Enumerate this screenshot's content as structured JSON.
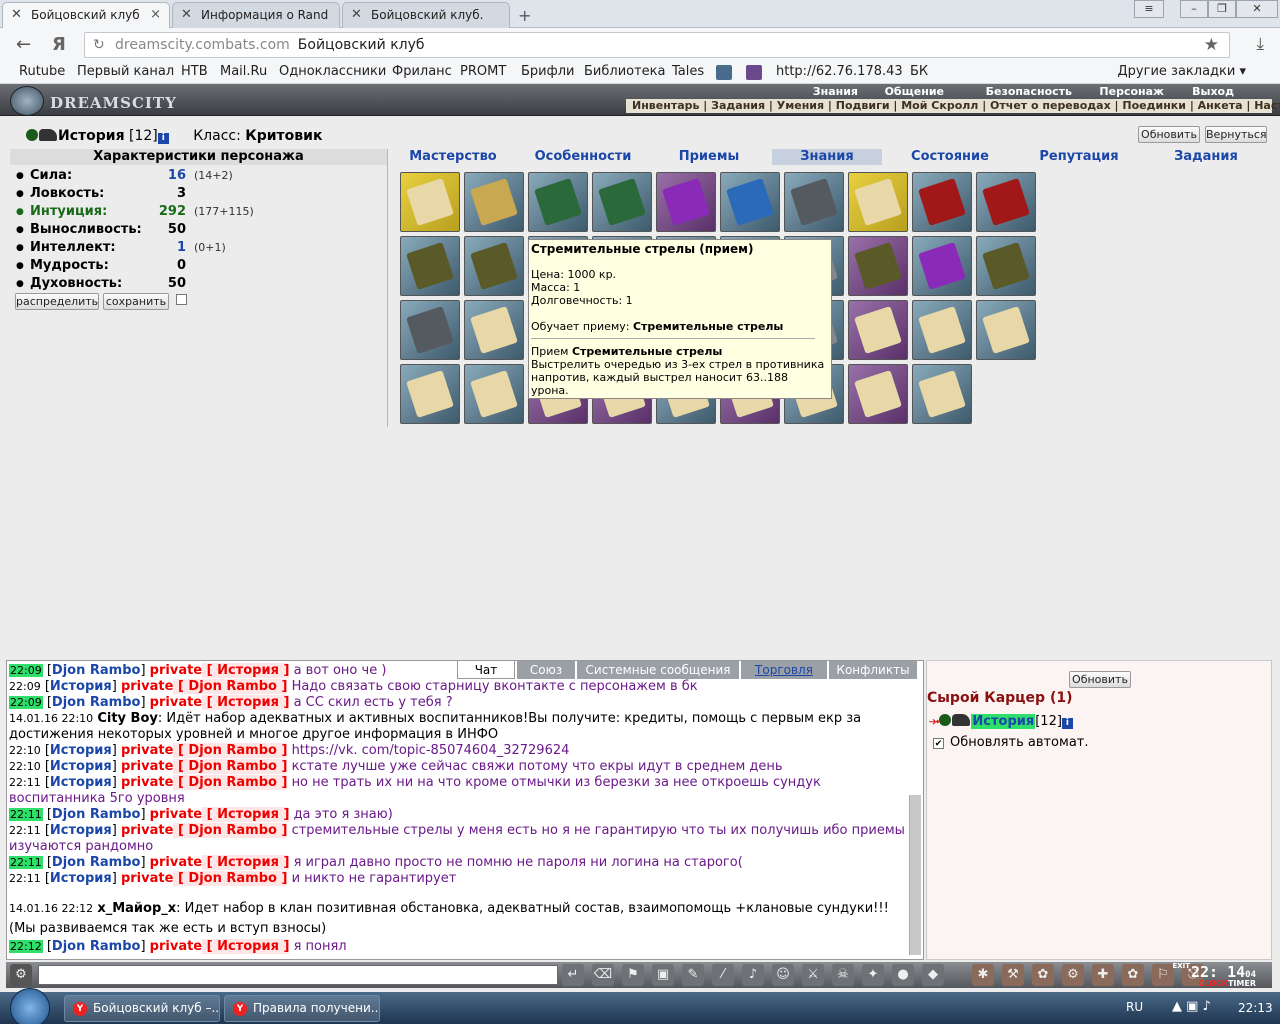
{
  "browser": {
    "tabs": [
      {
        "label": "Бойцовский клуб",
        "active": true
      },
      {
        "label": "Информация о Rand",
        "active": false
      },
      {
        "label": "Бойцовский клуб.",
        "active": false
      }
    ],
    "url": "dreamscity.combats.com",
    "page_title": "Бойцовский клуб",
    "bookmarks": [
      "Rutube",
      "Первый канал",
      "НТВ",
      "Mail.Ru",
      "Одноклассники",
      "Фриланс",
      "PROMT",
      "Брифли",
      "Библиотека",
      "Tales",
      "http://62.76.178.43",
      "БК"
    ],
    "other_bookmarks": "Другие закладки"
  },
  "game": {
    "logo": "DREAMSCITY",
    "top_menu": [
      "Знания",
      "Общение",
      "Безопасность",
      "Персонаж",
      "Выход"
    ],
    "sub_menu": [
      "Инвентарь",
      "Задания",
      "Умения",
      "Подвиги",
      "Мой Скролл",
      "Отчет о переводах",
      "Поединки",
      "Анкета",
      "Настройки"
    ],
    "character": {
      "name": "История",
      "level": "[12]",
      "class_label": "Класс:",
      "class_value": "Критовик",
      "info_icon": "i"
    },
    "buttons": {
      "refresh": "Обновить",
      "back": "Вернуться",
      "distribute": "распределить",
      "save": "сохранить"
    },
    "stats_header": "Характеристики персонажа",
    "stats": [
      {
        "name": "Сила:",
        "value": "16",
        "bonus": "(14+2)",
        "style": "blue"
      },
      {
        "name": "Ловкость:",
        "value": "3",
        "bonus": "",
        "style": "plain"
      },
      {
        "name": "Интуиция:",
        "value": "292",
        "bonus": "(177+115)",
        "style": "green"
      },
      {
        "name": "Выносливость:",
        "value": "50",
        "bonus": "",
        "style": "plain"
      },
      {
        "name": "Интеллект:",
        "value": "1",
        "bonus": "(0+1)",
        "style": "blue"
      },
      {
        "name": "Мудрость:",
        "value": "0",
        "bonus": "",
        "style": "plain"
      },
      {
        "name": "Духовность:",
        "value": "50",
        "bonus": "",
        "style": "plain"
      }
    ],
    "right_tabs": [
      "Мастерство",
      "Особенности",
      "Приемы",
      "Знания",
      "Состояние",
      "Репутация",
      "Задания"
    ],
    "selected_tab": "Знания",
    "tooltip": {
      "title": "Стремительные стрелы (прием)",
      "price": "Цена: 1000 кр.",
      "mass": "Масса: 1",
      "durability": "Долговечность: 1",
      "teaches_label": "Обучает приему:",
      "teaches_value": "Стремительные стрелы",
      "desc_label": "Прием",
      "desc_name": "Стремительные стрелы",
      "desc_text": "Выстрелить очередью из 3-ех стрел в противника напротив, каждый выстрел наносит 63..188 урона."
    }
  },
  "chat": {
    "tabs": [
      "Чат",
      "Союз",
      "Системные сообщения",
      "Торговля",
      "Конфликты"
    ],
    "lines": [
      {
        "time": "22:09",
        "hl": true,
        "from": "Djon Rambo",
        "to": "История",
        "text": "а вот оно че )"
      },
      {
        "time": "22:09",
        "hl": false,
        "from": "История",
        "to": "Djon Rambo",
        "text": "Надо связать свою старницу вконтакте с персонажем в бк"
      },
      {
        "time": "22:09",
        "hl": true,
        "from": "Djon Rambo",
        "to": "История",
        "text": "а СС скил есть у тебя ?"
      },
      {
        "time": "14.01.16 22:10",
        "hl": false,
        "city": "City Boy",
        "text": "Идёт набор адекватных и активных воспитанников!Вы получите: кредиты, помощь с первым екр за достижения некоторых уровней и многое другое информация в ИНФО"
      },
      {
        "time": "22:10",
        "hl": false,
        "from": "История",
        "to": "Djon Rambo",
        "text": "https://vk. com/topic-85074604_32729624"
      },
      {
        "time": "22:10",
        "hl": false,
        "from": "История",
        "to": "Djon Rambo",
        "text": "кстате лучше уже сейчас свяжи потому что екры идут в среднем день"
      },
      {
        "time": "22:11",
        "hl": false,
        "from": "История",
        "to": "Djon Rambo",
        "text": "но не трать их ни на что кроме отмычки из березки за нее откроешь сундук воспитанника 5го уровня"
      },
      {
        "time": "22:11",
        "hl": true,
        "from": "Djon Rambo",
        "to": "История",
        "text": "да это я знаю)"
      },
      {
        "time": "22:11",
        "hl": false,
        "from": "История",
        "to": "Djon Rambo",
        "text": "стремительные стрелы у меня есть но я не гарантирую что ты их получишь ибо приемы изучаются рандомно"
      },
      {
        "time": "22:11",
        "hl": true,
        "from": "Djon Rambo",
        "to": "История",
        "text": "я играл давно просто не помню не пароля ни логина на старого("
      },
      {
        "time": "22:11",
        "hl": false,
        "from": "История",
        "to": "Djon Rambo",
        "text": "и никто не гарантирует"
      },
      {
        "time": "14.01.16 22:12",
        "hl": false,
        "city": "x_Майор_x",
        "text": "Идет набор в клан  позитивная обстановка, адекватный состав, взаимопомощь +клановые сундуки!!! (Мы развиваемся так же есть и вступ взносы)"
      },
      {
        "time": "22:12",
        "hl": true,
        "from": "Djon Rambo",
        "to": "История",
        "text": "я понял"
      }
    ],
    "private_label": "private"
  },
  "room": {
    "refresh": "Обновить",
    "name": "Сырой Карцер (1)",
    "user": "История",
    "user_level": "[12]",
    "auto_update": "Обновлять автомат."
  },
  "bottombar": {
    "clock": "22: 14",
    "clock_sec": "04",
    "clock_label": "CLOCK",
    "timer_label": "TIMER",
    "exit_label": "EXIT"
  },
  "taskbar": {
    "tasks": [
      "Бойцовский клуб –...",
      "Правила получени..."
    ],
    "lang": "RU",
    "time": "22:13"
  },
  "colors": {
    "accent": "#1b47a8",
    "private": "#ee0000",
    "highlight": "#2ee06a"
  }
}
